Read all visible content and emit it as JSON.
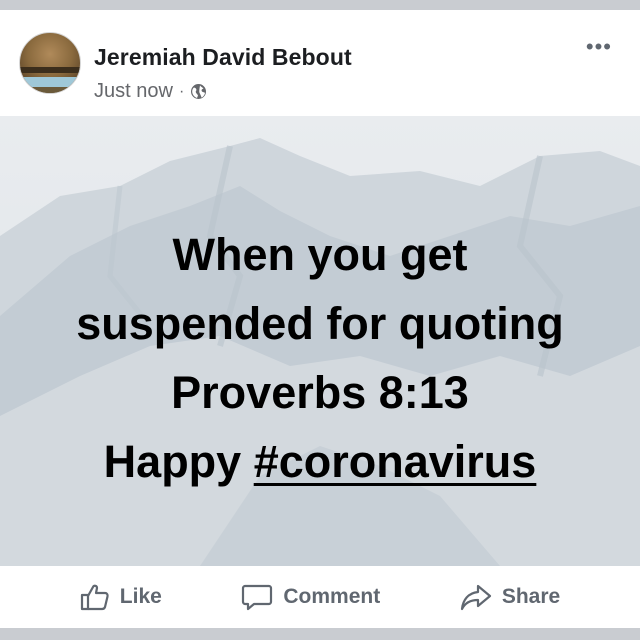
{
  "post": {
    "author": "Jeremiah David Bebout",
    "timestamp": "Just now",
    "separator": "·",
    "privacy_icon": "globe-icon",
    "more_label": "•••",
    "text_lines": [
      "When you get",
      "suspended for quoting",
      "Proverbs 8:13"
    ],
    "last_line_prefix": "Happy ",
    "hashtag": "#coronavirus"
  },
  "actions": {
    "like_label": "Like",
    "comment_label": "Comment",
    "share_label": "Share"
  },
  "colors": {
    "author": "#1c1e21",
    "meta": "#65676b",
    "action": "#606770",
    "page_bg": "#c9ccd1",
    "image_bg": "#e4e8ec"
  }
}
